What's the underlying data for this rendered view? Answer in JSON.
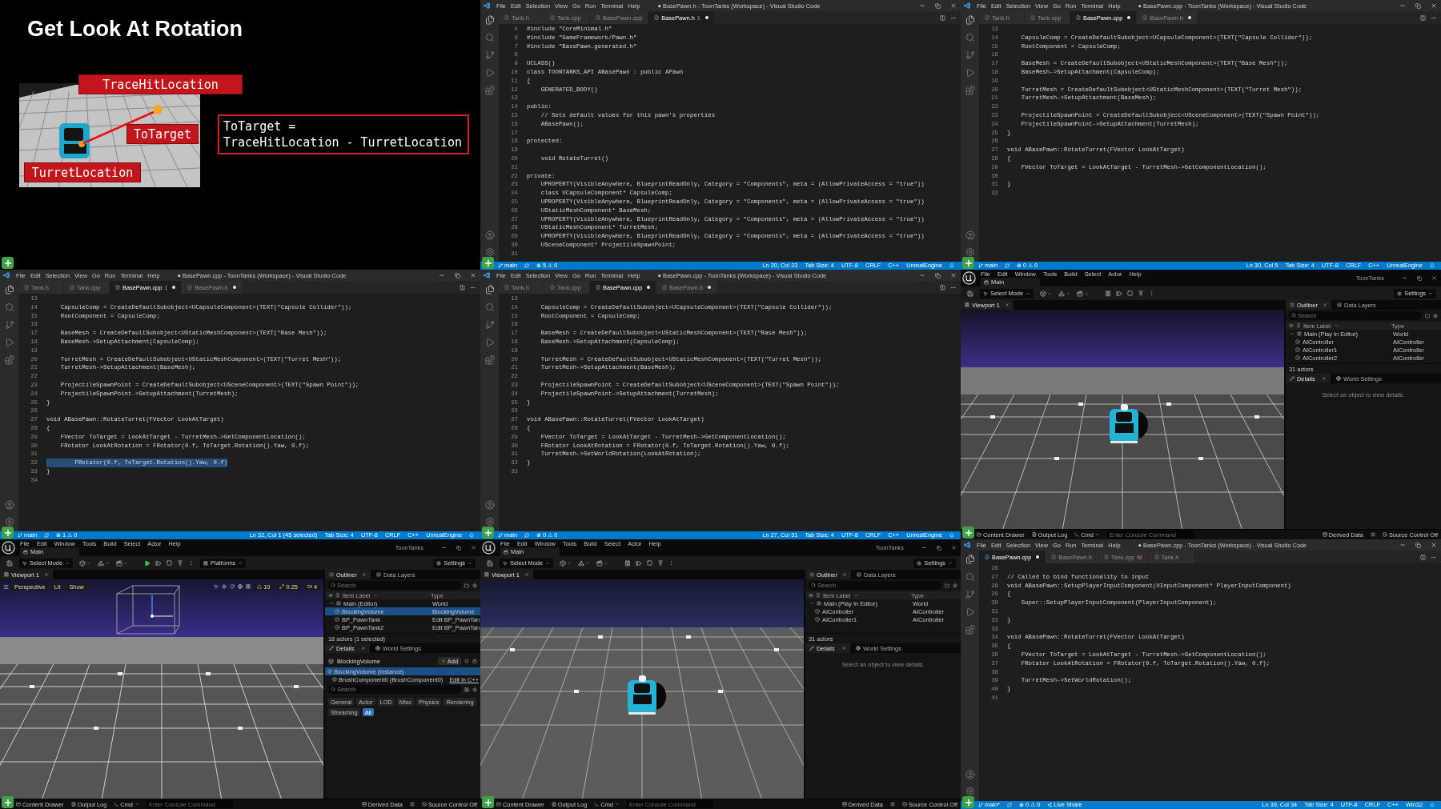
{
  "frames": [
    {
      "kind": "slide",
      "title": "Get Look At Rotation",
      "labels": [
        "TraceHitLocation",
        "ToTarget",
        "TurretLocation"
      ],
      "formula": [
        "ToTarget =",
        "TraceHitLocation - TurretLocation"
      ]
    },
    {
      "kind": "code",
      "title": "● BasePawn.h - ToonTanks (Workspace) - Visual Studio Code",
      "menu": [
        "File",
        "Edit",
        "Selection",
        "View",
        "Go",
        "Run",
        "Terminal",
        "Help"
      ],
      "tabs": [
        {
          "label": "Tank.h",
          "selected": false,
          "modified": false
        },
        {
          "label": "Tank.cpp",
          "selected": false,
          "modified": false
        },
        {
          "label": "BasePawn.cpp",
          "selected": false,
          "modified": false
        },
        {
          "label": "BasePawn.h",
          "badge": "1",
          "selected": true,
          "modified": true
        }
      ],
      "lines": [
        {
          "n": "5",
          "code": "#include \"CoreMinimal.h\""
        },
        {
          "n": "6",
          "code": "#include \"GameFramework/Pawn.h\""
        },
        {
          "n": "7",
          "code": "#include \"BasePawn.generated.h\""
        },
        {
          "n": "8"
        },
        {
          "n": "9",
          "code": "UCLASS()"
        },
        {
          "n": "10",
          "code": "class TOONTANKS_API ABasePawn : public APawn"
        },
        {
          "n": "11",
          "code": "{"
        },
        {
          "n": "12",
          "code": "    GENERATED_BODY()"
        },
        {
          "n": "13"
        },
        {
          "n": "14",
          "code": "public:"
        },
        {
          "n": "15",
          "code": "    // Sets default values for this pawn's properties"
        },
        {
          "n": "16",
          "code": "    ABasePawn();"
        },
        {
          "n": "17"
        },
        {
          "n": "18",
          "code": "protected:"
        },
        {
          "n": "19"
        },
        {
          "n": "20",
          "code": "    void RotateTurret()"
        },
        {
          "n": "21"
        },
        {
          "n": "22",
          "code": "private:"
        },
        {
          "n": "23",
          "code": "    UPROPERTY(VisibleAnywhere, BlueprintReadOnly, Category = \"Components\", meta = (AllowPrivateAccess = \"true\"))"
        },
        {
          "n": "24",
          "code": "    class UCapsuleComponent* CapsuleComp;"
        },
        {
          "n": "25",
          "code": "    UPROPERTY(VisibleAnywhere, BlueprintReadOnly, Category = \"Components\", meta = (AllowPrivateAccess = \"true\"))"
        },
        {
          "n": "26",
          "code": "    UStaticMeshComponent* BaseMesh;"
        },
        {
          "n": "27",
          "code": "    UPROPERTY(VisibleAnywhere, BlueprintReadOnly, Category = \"Components\", meta = (AllowPrivateAccess = \"true\"))"
        },
        {
          "n": "28",
          "code": "    UStaticMeshComponent* TurretMesh;"
        },
        {
          "n": "29",
          "code": "    UPROPERTY(VisibleAnywhere, BlueprintReadOnly, Category = \"Components\", meta = (AllowPrivateAccess = \"true\"))"
        },
        {
          "n": "30",
          "code": "    USceneComponent* ProjectileSpawnPoint;"
        },
        {
          "n": "31"
        }
      ],
      "status_left": [
        "main",
        "⊗ 5 ⚠ 0"
      ],
      "status_right": [
        "Ln 20, Col 23",
        "Tab Size: 4",
        "UTF-8",
        "CRLF",
        "C++",
        "UnrealEngine"
      ]
    },
    {
      "kind": "code",
      "title": "● BasePawn.cpp - ToonTanks (Workspace) - Visual Studio Code",
      "menu": [
        "File",
        "Edit",
        "Selection",
        "View",
        "Go",
        "Run",
        "Terminal",
        "Help"
      ],
      "tabs": [
        {
          "label": "Tank.h",
          "selected": false,
          "modified": false
        },
        {
          "label": "Tank.cpp",
          "selected": false,
          "modified": false
        },
        {
          "label": "BasePawn.cpp",
          "selected": true,
          "modified": true
        },
        {
          "label": "BasePawn.h",
          "selected": false,
          "modified": true
        }
      ],
      "lines": [
        {
          "n": "13"
        },
        {
          "n": "14",
          "code": "    CapsuleComp = CreateDefaultSubobject<UCapsuleComponent>(TEXT(\"Capsule Collider\"));"
        },
        {
          "n": "15",
          "code": "    RootComponent = CapsuleComp;"
        },
        {
          "n": "16"
        },
        {
          "n": "17",
          "code": "    BaseMesh = CreateDefaultSubobject<UStaticMeshComponent>(TEXT(\"Base Mesh\"));"
        },
        {
          "n": "18",
          "code": "    BaseMesh->SetupAttachment(CapsuleComp);"
        },
        {
          "n": "19"
        },
        {
          "n": "20",
          "code": "    TurretMesh = CreateDefaultSubobject<UStaticMeshComponent>(TEXT(\"Turret Mesh\"));"
        },
        {
          "n": "21",
          "code": "    TurretMesh->SetupAttachment(BaseMesh);"
        },
        {
          "n": "22"
        },
        {
          "n": "23",
          "code": "    ProjectileSpawnPoint = CreateDefaultSubobject<USceneComponent>(TEXT(\"Spawn Point\"));"
        },
        {
          "n": "24",
          "code": "    ProjectileSpawnPoint->SetupAttachment(TurretMesh);"
        },
        {
          "n": "25",
          "code": "}"
        },
        {
          "n": "26"
        },
        {
          "n": "27",
          "code": "void ABasePawn::RotateTurret(FVector LookAtTarget)"
        },
        {
          "n": "28",
          "code": "{"
        },
        {
          "n": "29",
          "code": "    FVector ToTarget = LookAtTarget - TurretMesh->GetComponentLocation();"
        },
        {
          "n": "30"
        },
        {
          "n": "31",
          "code": "}"
        },
        {
          "n": "32"
        }
      ],
      "status_left": [
        "main",
        "⊗ 0 ⚠ 0"
      ],
      "status_right": [
        "Ln 30, Col 5",
        "Tab Size: 4",
        "UTF-8",
        "CRLF",
        "C++",
        "UnrealEngine"
      ]
    },
    {
      "kind": "code",
      "title": "● BasePawn.cpp - ToonTanks (Workspace) - Visual Studio Code",
      "menu": [
        "File",
        "Edit",
        "Selection",
        "View",
        "Go",
        "Run",
        "Terminal",
        "Help"
      ],
      "tabs": [
        {
          "label": "Tank.h",
          "selected": false,
          "modified": false
        },
        {
          "label": "Tank.cpp",
          "selected": false,
          "modified": false
        },
        {
          "label": "BasePawn.cpp",
          "badge": "1",
          "selected": true,
          "modified": true
        },
        {
          "label": "BasePawn.h",
          "selected": false,
          "modified": true
        }
      ],
      "lines": [
        {
          "n": "13",
          "highlighted": false
        },
        {
          "n": "14",
          "code": "    CapsuleComp = CreateDefaultSubobject<UCapsuleComponent>(TEXT(\"Capsule Collider\"));",
          "highlighted": false
        },
        {
          "n": "15",
          "code": "    RootComponent = CapsuleComp;",
          "highlighted": false
        },
        {
          "n": "16",
          "highlighted": false
        },
        {
          "n": "17",
          "code": "    BaseMesh = CreateDefaultSubobject<UStaticMeshComponent>(TEXT(\"Base Mesh\"));",
          "highlighted": false
        },
        {
          "n": "18",
          "code": "    BaseMesh->SetupAttachment(CapsuleComp);",
          "highlighted": false
        },
        {
          "n": "19",
          "highlighted": false
        },
        {
          "n": "20",
          "code": "    TurretMesh = CreateDefaultSubobject<UStaticMeshComponent>(TEXT(\"Turret Mesh\"));",
          "highlighted": false
        },
        {
          "n": "21",
          "code": "    TurretMesh->SetupAttachment(BaseMesh);",
          "highlighted": false
        },
        {
          "n": "22",
          "highlighted": false
        },
        {
          "n": "23",
          "code": "    ProjectileSpawnPoint = CreateDefaultSubobject<USceneComponent>(TEXT(\"Spawn Point\"));",
          "highlighted": false
        },
        {
          "n": "24",
          "code": "    ProjectileSpawnPoint->SetupAttachment(TurretMesh);",
          "highlighted": false
        },
        {
          "n": "25",
          "code": "}",
          "highlighted": false
        },
        {
          "n": "26",
          "highlighted": false
        },
        {
          "n": "27",
          "code": "void ABasePawn::RotateTurret(FVector LookAtTarget)",
          "highlighted": false
        },
        {
          "n": "28",
          "code": "{",
          "highlighted": false
        },
        {
          "n": "29",
          "code": "    FVector ToTarget = LookAtTarget - TurretMesh->GetComponentLocation();",
          "highlighted": false
        },
        {
          "n": "30",
          "code": "    FRotator LookAtRotation = FRotator(0.f, ToTarget.Rotation().Yaw, 0.f);",
          "highlighted": false
        },
        {
          "n": "31",
          "highlighted": false
        },
        {
          "n": "32",
          "code": "        FRotator(0.f, ToTarget.Rotation().Yaw, 0.f)",
          "highlighted": true
        },
        {
          "n": "33",
          "code": "}",
          "highlighted": false
        },
        {
          "n": "34",
          "highlighted": false
        }
      ],
      "status_left": [
        "main",
        "⊗ 1 ⚠ 0"
      ],
      "status_right": [
        "Ln 32, Col 1 (45 selected)",
        "Tab Size: 4",
        "UTF-8",
        "CRLF",
        "C++",
        "UnrealEngine"
      ]
    },
    {
      "kind": "code",
      "title": "● BasePawn.cpp - ToonTanks (Workspace) - Visual Studio Code",
      "menu": [
        "File",
        "Edit",
        "Selection",
        "View",
        "Go",
        "Run",
        "Terminal",
        "Help"
      ],
      "tabs": [
        {
          "label": "Tank.h",
          "selected": false,
          "modified": false
        },
        {
          "label": "Tank.cpp",
          "selected": false,
          "modified": false
        },
        {
          "label": "BasePawn.cpp",
          "selected": true,
          "modified": true
        },
        {
          "label": "BasePawn.h",
          "selected": false,
          "modified": true
        }
      ],
      "lines": [
        {
          "n": "13"
        },
        {
          "n": "14",
          "code": "    CapsuleComp = CreateDefaultSubobject<UCapsuleComponent>(TEXT(\"Capsule Collider\"));"
        },
        {
          "n": "15",
          "code": "    RootComponent = CapsuleComp;"
        },
        {
          "n": "16"
        },
        {
          "n": "17",
          "code": "    BaseMesh = CreateDefaultSubobject<UStaticMeshComponent>(TEXT(\"Base Mesh\"));"
        },
        {
          "n": "18",
          "code": "    BaseMesh->SetupAttachment(CapsuleComp);"
        },
        {
          "n": "19"
        },
        {
          "n": "20",
          "code": "    TurretMesh = CreateDefaultSubobject<UStaticMeshComponent>(TEXT(\"Turret Mesh\"));"
        },
        {
          "n": "21",
          "code": "    TurretMesh->SetupAttachment(BaseMesh);"
        },
        {
          "n": "22"
        },
        {
          "n": "23",
          "code": "    ProjectileSpawnPoint = CreateDefaultSubobject<USceneComponent>(TEXT(\"Spawn Point\"));"
        },
        {
          "n": "24",
          "code": "    ProjectileSpawnPoint->SetupAttachment(TurretMesh);"
        },
        {
          "n": "25",
          "code": "}"
        },
        {
          "n": "26"
        },
        {
          "n": "27",
          "code": "void ABasePawn::RotateTurret(FVector LookAtTarget)"
        },
        {
          "n": "28",
          "code": "{"
        },
        {
          "n": "29",
          "code": "    FVector ToTarget = LookAtTarget - TurretMesh->GetComponentLocation();"
        },
        {
          "n": "30",
          "code": "    FRotator LookAtRotation = FRotator(0.f, ToTarget.Rotation().Yaw, 0.f);"
        },
        {
          "n": "31",
          "code": "    TurretMesh->SetWorldRotation(LookAtRotation);"
        },
        {
          "n": "32",
          "code": "}"
        },
        {
          "n": "33"
        }
      ],
      "status_left": [
        "main",
        "⊗ 0 ⚠ 0"
      ],
      "status_right": [
        "Ln 27, Col 51",
        "Tab Size: 4",
        "UTF-8",
        "CRLF",
        "C++",
        "UnrealEngine"
      ]
    },
    {
      "kind": "unreal",
      "menu": [
        "File",
        "Edit",
        "Window",
        "Tools",
        "Build",
        "Select",
        "Actor",
        "Help"
      ],
      "level": "Main",
      "project": "ToonTanks",
      "mode": "Select Mode",
      "playing": true,
      "settings": "Settings",
      "viewport": {
        "tab": "Viewport 1",
        "kind": "sky"
      },
      "outliner_tabs": [
        {
          "label": "Outliner",
          "selected": true
        },
        {
          "label": "Data Layers",
          "selected": false
        }
      ],
      "search": {
        "placeholder": "Search"
      },
      "columns": [
        "Item Label",
        "Type"
      ],
      "rows": [
        {
          "label": "Main (Play In Editor)",
          "type": "World",
          "expanded": true,
          "children": [
            {
              "label": "AIController",
              "type": "AIController"
            },
            {
              "label": "AIController1",
              "type": "AIController"
            },
            {
              "label": "AIController2",
              "type": "AIController"
            }
          ]
        }
      ],
      "actor_count": "31 actors",
      "details_tabs": [
        {
          "label": "Details",
          "selected": true
        },
        {
          "label": "World Settings",
          "selected": false
        }
      ],
      "details_empty": "Select an object to view details.",
      "bottom_left": [
        "Content Drawer",
        "Output Log",
        "Cmd"
      ],
      "console": {
        "placeholder": "Enter Console Command"
      },
      "bottom_right": [
        "Derived Data",
        "Source Control Off"
      ]
    },
    {
      "kind": "unreal",
      "menu": [
        "File",
        "Edit",
        "Window",
        "Tools",
        "Build",
        "Select",
        "Actor",
        "Help"
      ],
      "level": "Main",
      "project": "ToonTanks",
      "mode": "Select Mode",
      "playing": false,
      "platforms": "Platforms",
      "settings": "Settings",
      "viewport": {
        "tab": "Viewport 1",
        "kind": "editor",
        "buttons": [
          "Perspective",
          "Lit",
          "Show"
        ],
        "values": [
          "10",
          "0.25",
          "4"
        ]
      },
      "outliner_tabs": [
        {
          "label": "Outliner",
          "selected": true
        },
        {
          "label": "Data Layers",
          "selected": false
        }
      ],
      "search": {
        "placeholder": "Search"
      },
      "columns": [
        "Item Label",
        "Type"
      ],
      "rows": [
        {
          "label": "Main (Editor)",
          "type": "World",
          "expanded": true,
          "selected": false,
          "children": [
            {
              "label": "BlockingVolume",
              "type": "BlockingVolume",
              "selected": true
            },
            {
              "label": "BP_PawnTank",
              "type": "Edit BP_PawnTan",
              "selected": false
            },
            {
              "label": "BP_PawnTank2",
              "type": "Edit BP_PawnTan",
              "selected": false
            }
          ]
        }
      ],
      "actor_count": "18 actors (1 selected)",
      "details_tabs": [
        {
          "label": "Details",
          "selected": true
        },
        {
          "label": "World Settings",
          "selected": false
        }
      ],
      "details": {
        "actor": "BlockingVolume",
        "add": "Add",
        "components": [
          {
            "label": "BlockingVolume (Instance)",
            "selected": true
          },
          {
            "label": "BrushComponent0 (BrushComponent0)",
            "selected": false,
            "action": "Edit in C++"
          }
        ],
        "search": {
          "placeholder": "Search"
        },
        "filters": [
          {
            "label": "General",
            "selected": false
          },
          {
            "label": "Actor",
            "selected": false
          },
          {
            "label": "LOD",
            "selected": false
          },
          {
            "label": "Misc",
            "selected": false
          },
          {
            "label": "Physics",
            "selected": false
          },
          {
            "label": "Rendering",
            "selected": false
          },
          {
            "label": "Streaming",
            "selected": false
          },
          {
            "label": "All",
            "selected": true
          }
        ]
      },
      "bottom_left": [
        "Content Drawer",
        "Output Log",
        "Cmd"
      ],
      "console": {
        "placeholder": "Enter Console Command"
      },
      "bottom_right": [
        "Derived Data",
        "Source Control Off"
      ]
    },
    {
      "kind": "unreal",
      "menu": [
        "File",
        "Edit",
        "Window",
        "Tools",
        "Build",
        "Select",
        "Actor",
        "Help"
      ],
      "level": "Main",
      "project": "ToonTanks",
      "mode": "Select Mode",
      "playing": true,
      "settings": "Settings",
      "viewport": {
        "tab": "Viewport 1",
        "kind": "night"
      },
      "outliner_tabs": [
        {
          "label": "Outliner",
          "selected": true
        },
        {
          "label": "Data Layers",
          "selected": false
        }
      ],
      "search": {
        "placeholder": "Search"
      },
      "columns": [
        "Item Label",
        "Type"
      ],
      "rows": [
        {
          "label": "Main (Play In Editor)",
          "type": "World",
          "expanded": true,
          "children": [
            {
              "label": "AIController",
              "type": "AIController"
            },
            {
              "label": "AIController1",
              "type": "AIController"
            }
          ]
        }
      ],
      "actor_count": "31 actors",
      "details_tabs": [
        {
          "label": "Details",
          "selected": true
        },
        {
          "label": "World Settings",
          "selected": false
        }
      ],
      "details_empty": "Select an object to view details.",
      "bottom_left": [
        "Content Drawer",
        "Output Log",
        "Cmd"
      ],
      "console": {
        "placeholder": "Enter Console Command"
      },
      "bottom_right": [
        "Derived Data",
        "Source Control Off"
      ]
    },
    {
      "kind": "code",
      "title": "● BasePawn.cpp - ToonTanks (Workspace) - Visual Studio Code",
      "menu": [
        "File",
        "Edit",
        "Selection",
        "View",
        "Go",
        "Run",
        "Terminal",
        "Help"
      ],
      "tabs": [
        {
          "label": "BasePawn.cpp",
          "selected": true,
          "modified": true
        },
        {
          "label": "BasePawn.h",
          "selected": false,
          "modified": false
        },
        {
          "label": "Tank.cpp",
          "badge": "M",
          "selected": false,
          "modified": false
        },
        {
          "label": "Tank.h",
          "selected": false,
          "modified": false
        }
      ],
      "lines": [
        {
          "n": "26"
        },
        {
          "n": "27",
          "code": "// Called to bind functionality to input"
        },
        {
          "n": "28",
          "code": "void ABasePawn::SetupPlayerInputComponent(UInputComponent* PlayerInputComponent)"
        },
        {
          "n": "29",
          "code": "{"
        },
        {
          "n": "30",
          "code": "    Super::SetupPlayerInputComponent(PlayerInputComponent);"
        },
        {
          "n": "31"
        },
        {
          "n": "32",
          "code": "}"
        },
        {
          "n": "33"
        },
        {
          "n": "34",
          "code": "void ABasePawn::RotateTurret(FVector LookAtTarget)"
        },
        {
          "n": "35",
          "code": "{"
        },
        {
          "n": "36",
          "code": "    FVector ToTarget = LookAtTarget - TurretMesh->GetComponentLocation();"
        },
        {
          "n": "37",
          "code": "    FRotator LookAtRotation = FRotator(0.f, ToTarget.Rotation().Yaw, 0.f);"
        },
        {
          "n": "38"
        },
        {
          "n": "39",
          "code": "    TurretMesh->SetWorldRotation();"
        },
        {
          "n": "40",
          "code": "}"
        },
        {
          "n": "41"
        }
      ],
      "status_left": [
        "main*",
        "⊗ 0 ⚠ 0",
        "Live Share"
      ],
      "status_right": [
        "Ln 39, Col 34",
        "Tab Size: 4",
        "UTF-8",
        "CRLF",
        "C++",
        "Win32"
      ]
    }
  ]
}
